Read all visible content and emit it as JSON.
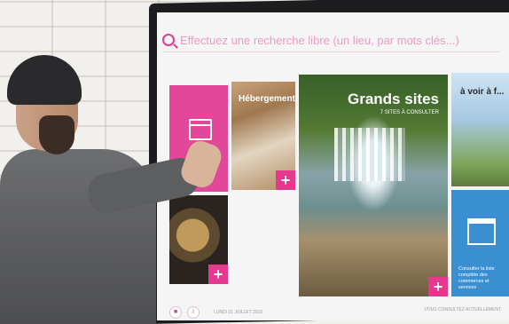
{
  "search": {
    "placeholder": "Effectuez une recherche libre (un lieu, par mots clés...)"
  },
  "tiles": {
    "hebergements": {
      "title": "Hébergements"
    },
    "grands_sites": {
      "title": "Grands sites",
      "subtitle": "7 SITES À CONSULTER"
    },
    "family": {
      "title": "à voir à f..."
    },
    "commerce": {
      "label": "Consulter la liste complète des commerces et services"
    },
    "plus": "+"
  },
  "footer": {
    "date": "LUNDI 31 JUILLET 2016",
    "right_text": "VOUS CONSULTEZ ACTUELLEMENT"
  },
  "colors": {
    "accent": "#e4398e",
    "blue_tile": "#3a8fd0"
  }
}
